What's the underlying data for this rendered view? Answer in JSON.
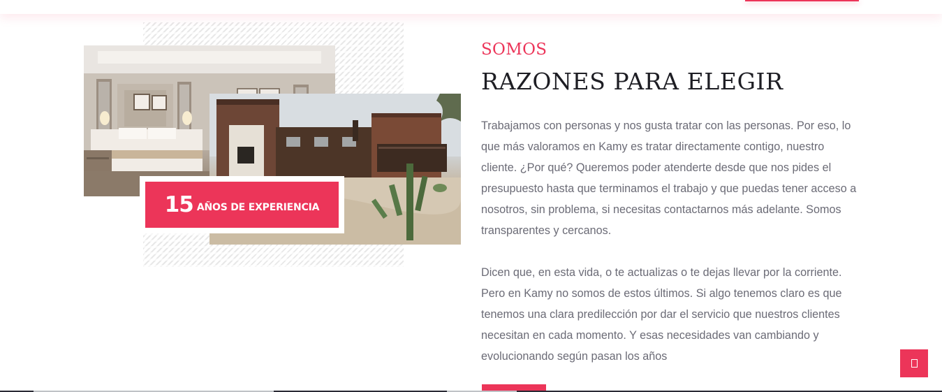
{
  "colors": {
    "accent": "#ec3559",
    "heading": "#1e1e24",
    "body_text": "#6b6b76"
  },
  "about": {
    "eyebrow": "SOMOS",
    "title": "RAZONES PARA ELEGIR",
    "paragraphs": [
      "Trabajamos con personas y nos gusta tratar con las personas. Por eso, lo que más valoramos en Kamy es tratar directamente contigo, nuestro cliente. ¿Por qué? Queremos poder atenderte desde que nos pides el presupuesto hasta que terminamos el trabajo y que puedas tener acceso a nosotros, sin problema, si necesitas contactarnos más adelante. Somos transparentes y cercanos.",
      "Dicen que, en esta vida, o te actualizas o te dejas llevar por la corriente. Pero en Kamy no somos de estos últimos. Si algo tenemos claro es que tenemos una clara predilección por dar el servicio que nuestros clientes necesitan en cada momento. Y esas necesidades van cambiando y evolucionando según pasan los años"
    ]
  },
  "badge": {
    "number": "15",
    "text": "AÑOS DE EXPERIENCIA"
  },
  "images": {
    "bedroom": "bedroom-photo",
    "exterior": "building-exterior-photo"
  },
  "scroll_top": {
    "icon": "arrow-up-icon"
  }
}
